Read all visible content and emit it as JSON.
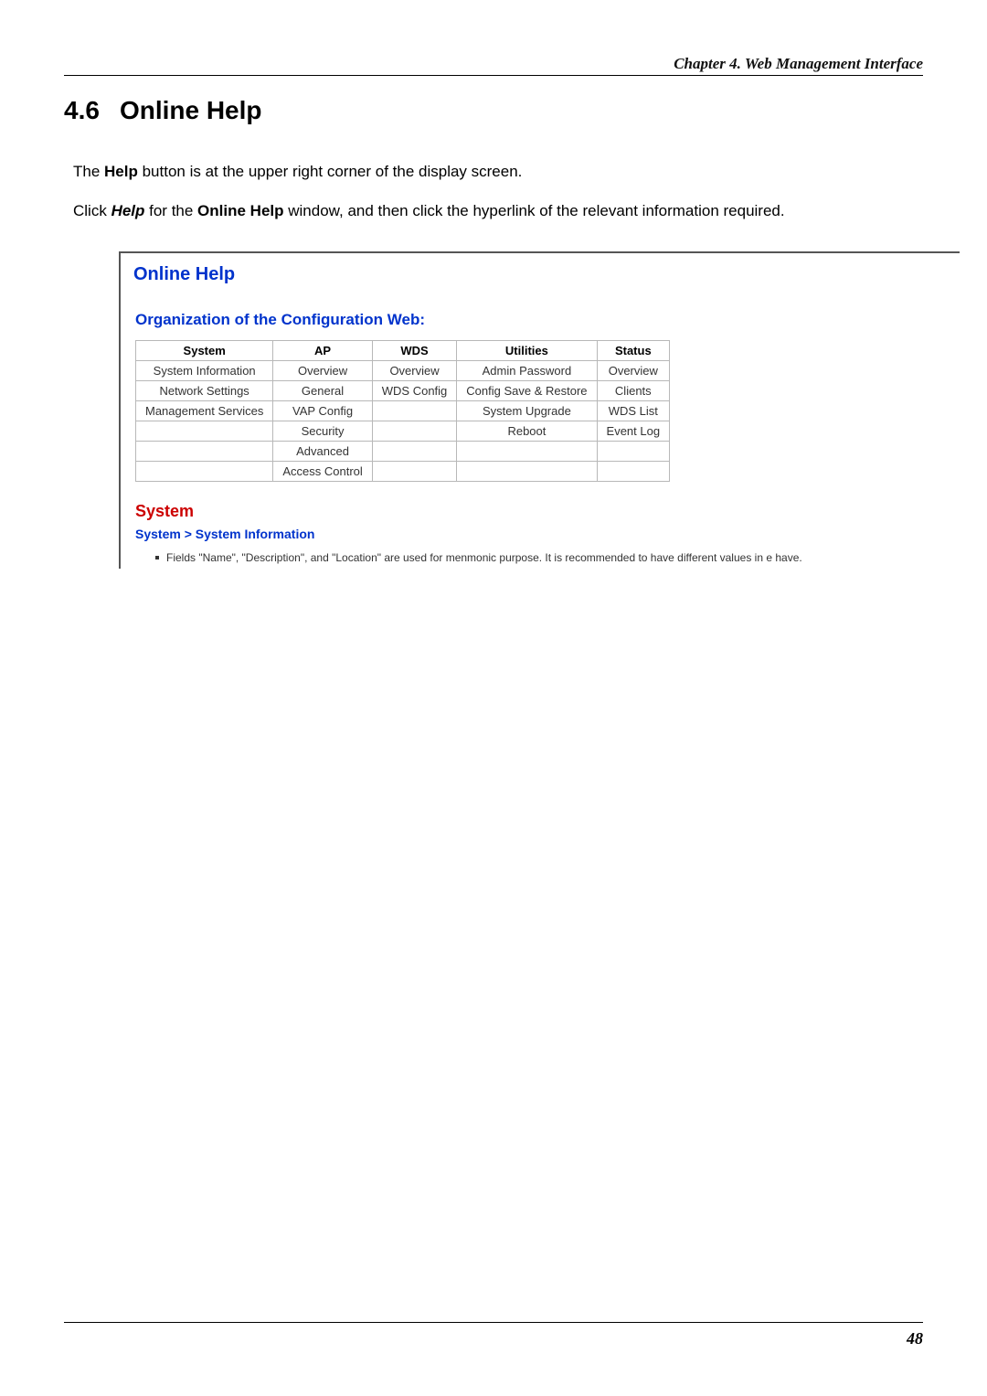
{
  "header": {
    "chapter": "Chapter 4. Web Management Interface"
  },
  "section": {
    "number": "4.6",
    "title": "Online Help"
  },
  "para1": {
    "pre": "The ",
    "bold1": "Help",
    "post": " button is at the upper right corner of the display screen."
  },
  "para2": {
    "pre": "Click ",
    "ital1": "Help",
    "mid1": " for the ",
    "bold1": "Online Help",
    "post": " window, and then click the hyperlink of the relevant information required."
  },
  "helpWindow": {
    "title": "Online Help",
    "orgTitle": "Organization of the Configuration Web:",
    "table": {
      "headers": [
        "System",
        "AP",
        "WDS",
        "Utilities",
        "Status"
      ],
      "rows": [
        [
          "System Information",
          "Overview",
          "Overview",
          "Admin Password",
          "Overview"
        ],
        [
          "Network Settings",
          "General",
          "WDS Config",
          "Config Save & Restore",
          "Clients"
        ],
        [
          "Management Services",
          "VAP Config",
          "",
          "System Upgrade",
          "WDS List"
        ],
        [
          "",
          "Security",
          "",
          "Reboot",
          "Event Log"
        ],
        [
          "",
          "Advanced",
          "",
          "",
          ""
        ],
        [
          "",
          "Access Control",
          "",
          "",
          ""
        ]
      ]
    },
    "systemHeading": "System",
    "breadcrumb": "System > System Information",
    "bullet": "Fields \"Name\", \"Description\", and \"Location\" are used for menmonic purpose. It is recommended to have different values in e have."
  },
  "footer": {
    "page": "48"
  }
}
